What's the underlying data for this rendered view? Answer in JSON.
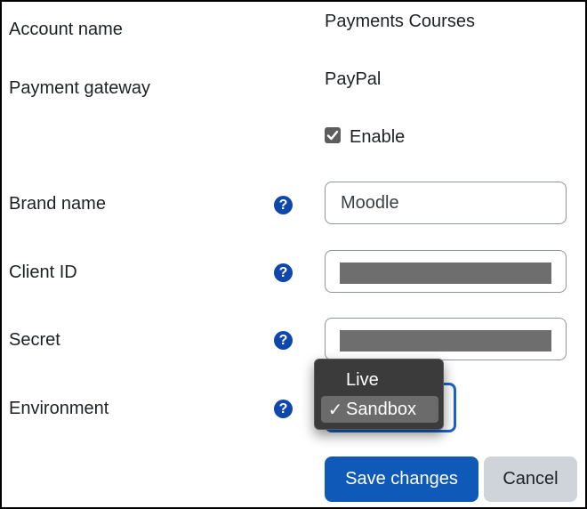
{
  "form": {
    "account_name": {
      "label": "Account name",
      "value": "Payments Courses"
    },
    "payment_gateway": {
      "label": "Payment gateway",
      "value": "PayPal"
    },
    "enable": {
      "label": "Enable",
      "checked": true
    },
    "brand_name": {
      "label": "Brand name",
      "value": "Moodle",
      "help_icon": "question-circle-icon"
    },
    "client_id": {
      "label": "Client ID",
      "value_redacted": true,
      "help_icon": "question-circle-icon"
    },
    "secret": {
      "label": "Secret",
      "value_redacted": true,
      "help_icon": "question-circle-icon"
    },
    "environment": {
      "label": "Environment",
      "help_icon": "question-circle-icon",
      "options": [
        "Live",
        "Sandbox"
      ],
      "selected": "Sandbox",
      "check_mark": "✓"
    }
  },
  "help_glyph": "?",
  "buttons": {
    "save": "Save changes",
    "cancel": "Cancel"
  },
  "colors": {
    "primary": "#0f5ab8",
    "help_icon": "#0f47ad",
    "focus_ring": "#1a63c8",
    "secondary_button": "#ced4da",
    "dropdown_bg": "#3b3b3b"
  }
}
